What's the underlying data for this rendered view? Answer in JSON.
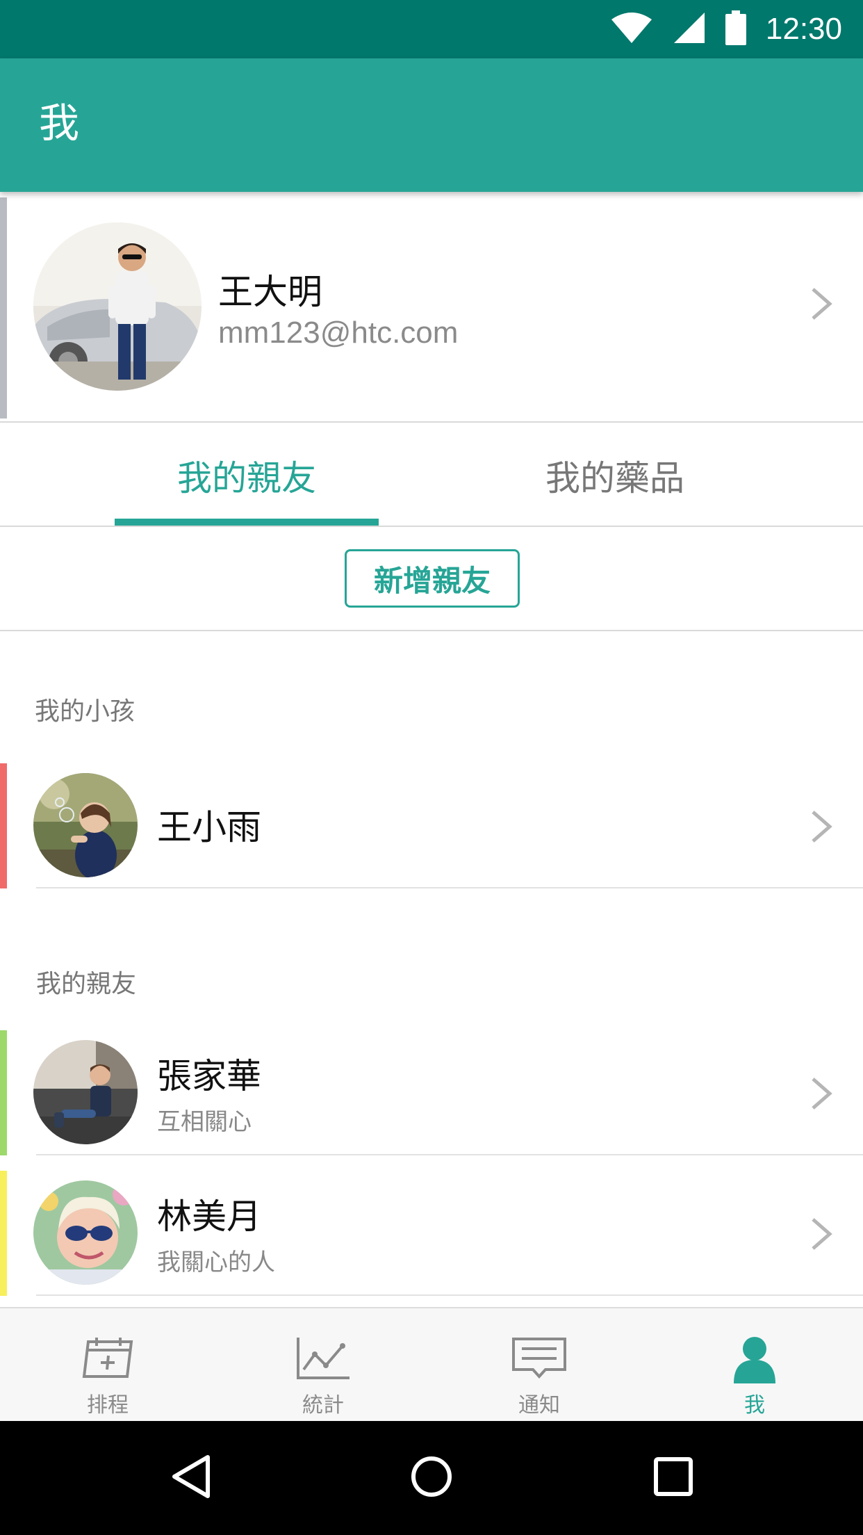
{
  "status_bar": {
    "time": "12:30",
    "icons": [
      "wifi-icon",
      "cellular-signal-icon",
      "battery-icon"
    ],
    "color": "#00786c"
  },
  "app_bar": {
    "title": "我",
    "color": "#26a596"
  },
  "profile": {
    "name": "王大明",
    "email": "mm123@htc.com",
    "accent_color": "#b8bcc2"
  },
  "tabs": [
    {
      "label": "我的親友",
      "selected": true
    },
    {
      "label": "我的藥品",
      "selected": false
    }
  ],
  "add_friend": {
    "label": "新增親友"
  },
  "sections": {
    "children": {
      "label": "我的小孩",
      "items": [
        {
          "name": "王小雨",
          "subtitle": "",
          "accent_color": "#f06a6a"
        }
      ]
    },
    "friends": {
      "label": "我的親友",
      "items": [
        {
          "name": "張家華",
          "subtitle": "互相關心",
          "accent_color": "#9cd86a"
        },
        {
          "name": "林美月",
          "subtitle": "我關心的人",
          "accent_color": "#f7ef5c"
        }
      ]
    }
  },
  "bottom_nav": [
    {
      "label": "排程",
      "icon": "calendar-add-icon",
      "active": false
    },
    {
      "label": "統計",
      "icon": "line-chart-icon",
      "active": false
    },
    {
      "label": "通知",
      "icon": "message-icon",
      "active": false
    },
    {
      "label": "我",
      "icon": "person-icon",
      "active": true
    }
  ],
  "system_nav": [
    "back-icon",
    "home-icon",
    "recents-icon"
  ],
  "accent_color": "#26a596"
}
